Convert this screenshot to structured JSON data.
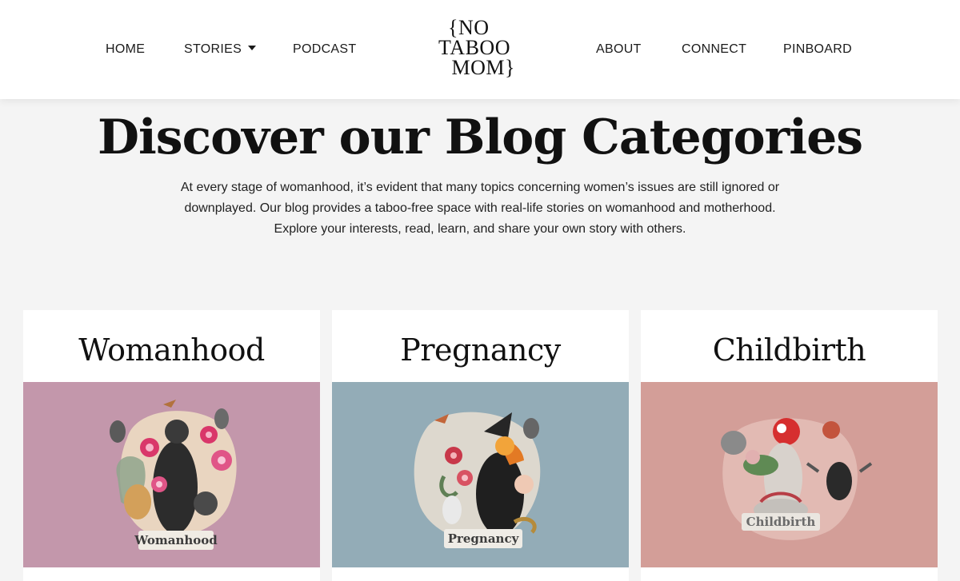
{
  "nav": {
    "home": "HOME",
    "stories": "STORIES",
    "podcast": "PODCAST",
    "about": "ABOUT",
    "connect": "CONNECT",
    "pinboard": "PINBOARD"
  },
  "logo": {
    "line1": "{NO",
    "line2": "TABOO",
    "line3": "MOM}"
  },
  "hero": {
    "title": "Discover our Blog Categories",
    "description": "At every stage of womanhood, it’s evident that many topics concerning women’s issues are still ignored or downplayed. Our blog provides a taboo-free space with real-life stories on womanhood and motherhood. Explore your interests, read, learn, and share your own story with others."
  },
  "categories": [
    {
      "title": "Womanhood",
      "image_label": "Womanhood",
      "bg_color": "#c397ab"
    },
    {
      "title": "Pregnancy",
      "image_label": "Pregnancy",
      "bg_color": "#93acb7"
    },
    {
      "title": "Childbirth",
      "image_label": "Childbirth",
      "bg_color": "#d39e98"
    }
  ],
  "colors": {
    "page_bg": "#f4f4f4",
    "header_bg": "#ffffff",
    "text": "#111111"
  }
}
